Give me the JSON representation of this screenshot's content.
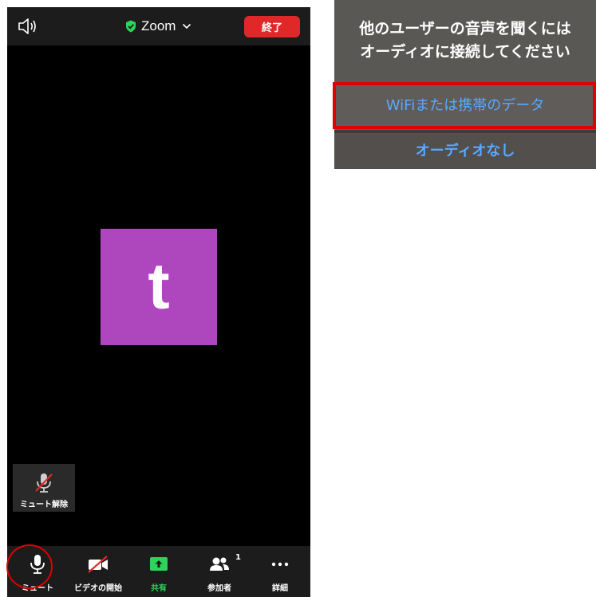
{
  "call": {
    "title": "Zoom",
    "end_label": "終了",
    "avatar_letter": "t",
    "unmute_tile_label": "ミュート解除",
    "colors": {
      "end": "#e02828",
      "avatar": "#ae46bd",
      "share": "#2dd35a"
    }
  },
  "toolbar": {
    "mute": "ミュート",
    "video": "ビデオの開始",
    "share": "共有",
    "participants": "参加者",
    "participants_count": "1",
    "more": "詳細"
  },
  "dialog": {
    "title_line1": "他のユーザーの音声を聞くには",
    "title_line2": "オーディオに接続してください",
    "option_wifi": "WiFiまたは携帯のデータ",
    "option_none": "オーディオなし",
    "option_color": "#5aa9ff"
  }
}
